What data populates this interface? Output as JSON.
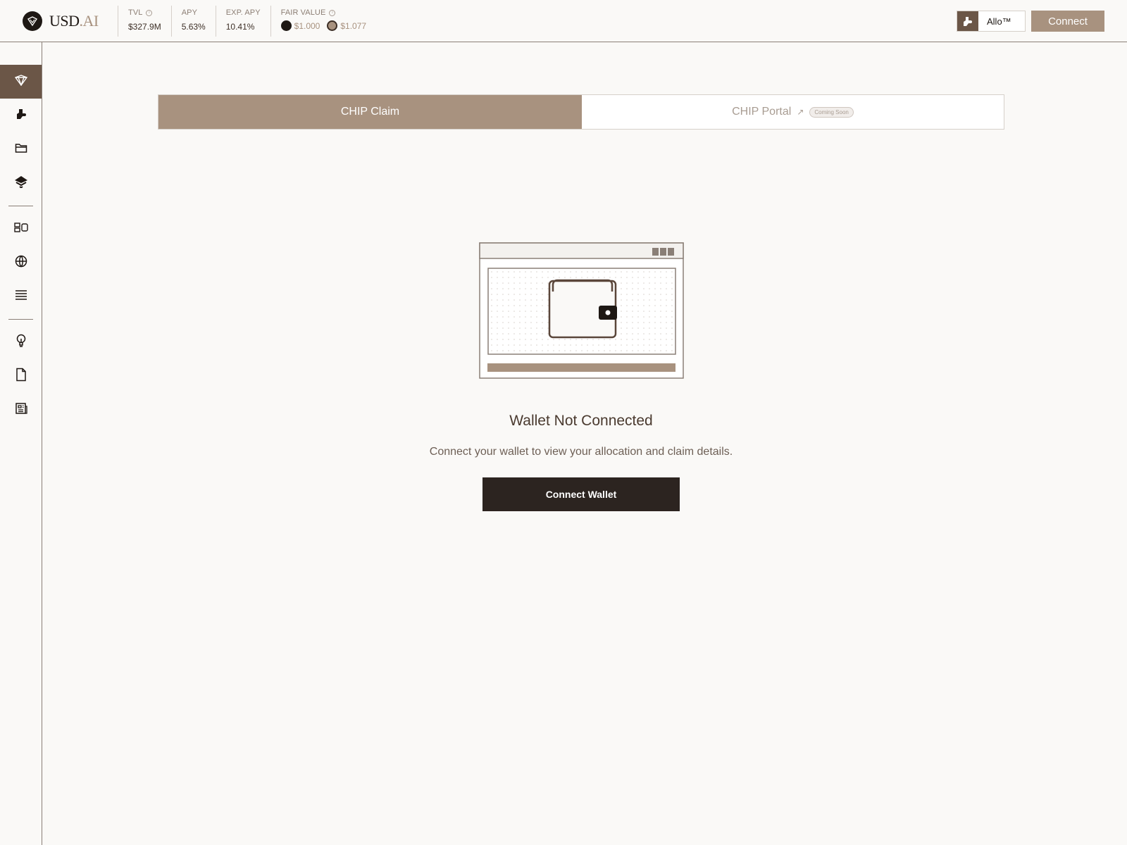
{
  "header": {
    "logo": {
      "main": "USD",
      "accent": ".AI"
    },
    "stats": [
      {
        "label": "TVL",
        "value": "$327.9M"
      },
      {
        "label": "APY",
        "value": "5.63%"
      },
      {
        "label": "EXP. APY",
        "value": "10.41%"
      }
    ],
    "fair_value": {
      "label": "FAIR VALUE",
      "values": [
        "$1.000",
        "$1.077"
      ]
    },
    "allo_label": "Allo™",
    "connect_label": "Connect"
  },
  "sidebar": {
    "items": [
      {
        "icon": "usdai-logo-icon",
        "active": true
      },
      {
        "icon": "allo-hand-icon"
      },
      {
        "icon": "folder-icon"
      },
      {
        "icon": "layers-icon"
      },
      {
        "icon": "dashboard-icon"
      },
      {
        "icon": "globe-icon"
      },
      {
        "icon": "list-icon"
      },
      {
        "icon": "lightbulb-icon"
      },
      {
        "icon": "document-icon"
      },
      {
        "icon": "newspaper-icon"
      }
    ]
  },
  "tabs": {
    "active": "CHIP Claim",
    "inactive": "CHIP Portal",
    "badge": "Coming Soon"
  },
  "main": {
    "title": "Wallet Not Connected",
    "subtitle": "Connect your wallet to view your allocation and claim details.",
    "button": "Connect Wallet"
  },
  "colors": {
    "accent": "#a8927f",
    "dark": "#2c2420",
    "sidebar_active": "#6b5647",
    "background": "#faf9f7"
  }
}
